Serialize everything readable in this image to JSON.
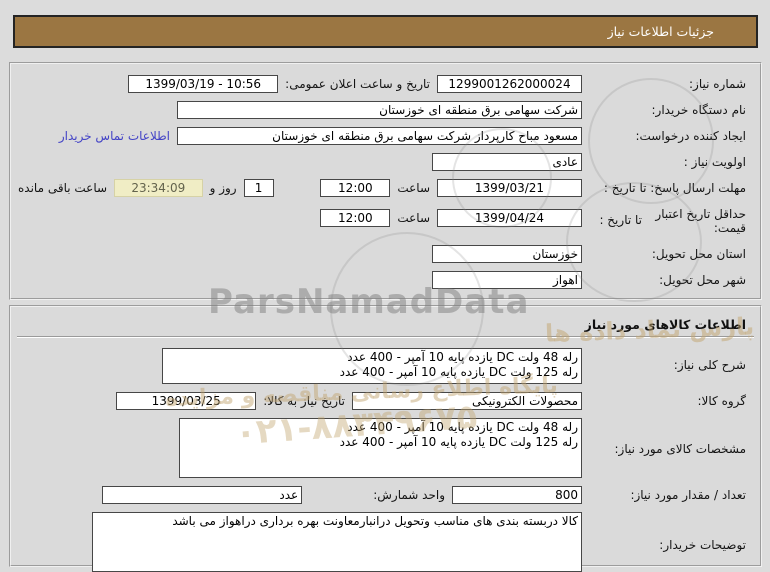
{
  "header": {
    "title": "جزئیات اطلاعات نیاز"
  },
  "p1": {
    "need_number_label": "شماره نیاز:",
    "need_number_value": "1299001262000024",
    "announce_label": "تاریخ و ساعت اعلان عمومی:",
    "announce_value": "1399/03/19 - 10:56",
    "buyer_org_label": "نام دستگاه خریدار:",
    "buyer_org_value": "شرکت سهامی برق منطقه ای خوزستان",
    "requester_label": "ایجاد کننده درخواست:",
    "requester_value": "مسعود مباح کارپرداز شرکت سهامی برق منطقه ای خوزستان",
    "contact_link": "اطلاعات تماس خریدار",
    "priority_label": "اولویت نیاز :",
    "priority_value": "عادی",
    "deadline_label": "مهلت ارسال پاسخ: تا تاریخ :",
    "deadline_date": "1399/03/21",
    "hour_label": "ساعت",
    "deadline_time": "12:00",
    "days_value": "1",
    "day_and_label": "روز و",
    "countdown_value": "23:34:09",
    "remaining_label": "ساعت باقی مانده",
    "validity_label": "حداقل تاریخ اعتبار قیمت:",
    "until_date_label": "تا تاریخ :",
    "validity_date": "1399/04/24",
    "validity_time": "12:00",
    "province_label": "استان محل تحویل:",
    "province_value": "خوزستان",
    "city_label": "شهر محل تحویل:",
    "city_value": "اهواز"
  },
  "p2": {
    "title": "اطلاعات کالاهای مورد نیاز",
    "desc_label": "شرح کلی نیاز:",
    "desc_value": "رله 48 ولت DC یازده پایه 10 آمپر - 400 عدد\nرله 125 ولت DC یازده پایه 10 آمپر - 400 عدد",
    "group_label": "گروه کالا:",
    "group_value": "محصولات الکترونیکی",
    "need_date_label": "تاریخ نیاز به کالا:",
    "need_date_value": "1399/03/25",
    "specs_label": "مشخصات کالای مورد نیاز:",
    "specs_value": "رله 48 ولت DC یازده پایه 10 آمپر - 400 عدد\nرله 125 ولت DC یازده پایه 10 آمپر - 400 عدد",
    "qty_label": "تعداد / مقدار مورد نیاز:",
    "qty_value": "800",
    "unit_label": "واحد شمارش:",
    "unit_value": "عدد",
    "notes_label": "توضیحات خریدار:",
    "notes_value": "کالا دربسته بندی های مناسب وتحویل درانبارمعاونت بهره برداری دراهواز می باشد"
  },
  "watermark": {
    "brand_en": "ParsNamadData",
    "brand_fa": "پارس نماد داده ها",
    "tagline": "پایگاه اطلاع رسانی مناقصه و مزایده",
    "phone": "۰۲۱-۸۸۳۴۹۶۷۵"
  },
  "colors": {
    "header_bg": "#9b7642",
    "link": "#4343c6",
    "countdown_bg": "#f0edc5",
    "page_bg": "#dcdcdc"
  }
}
